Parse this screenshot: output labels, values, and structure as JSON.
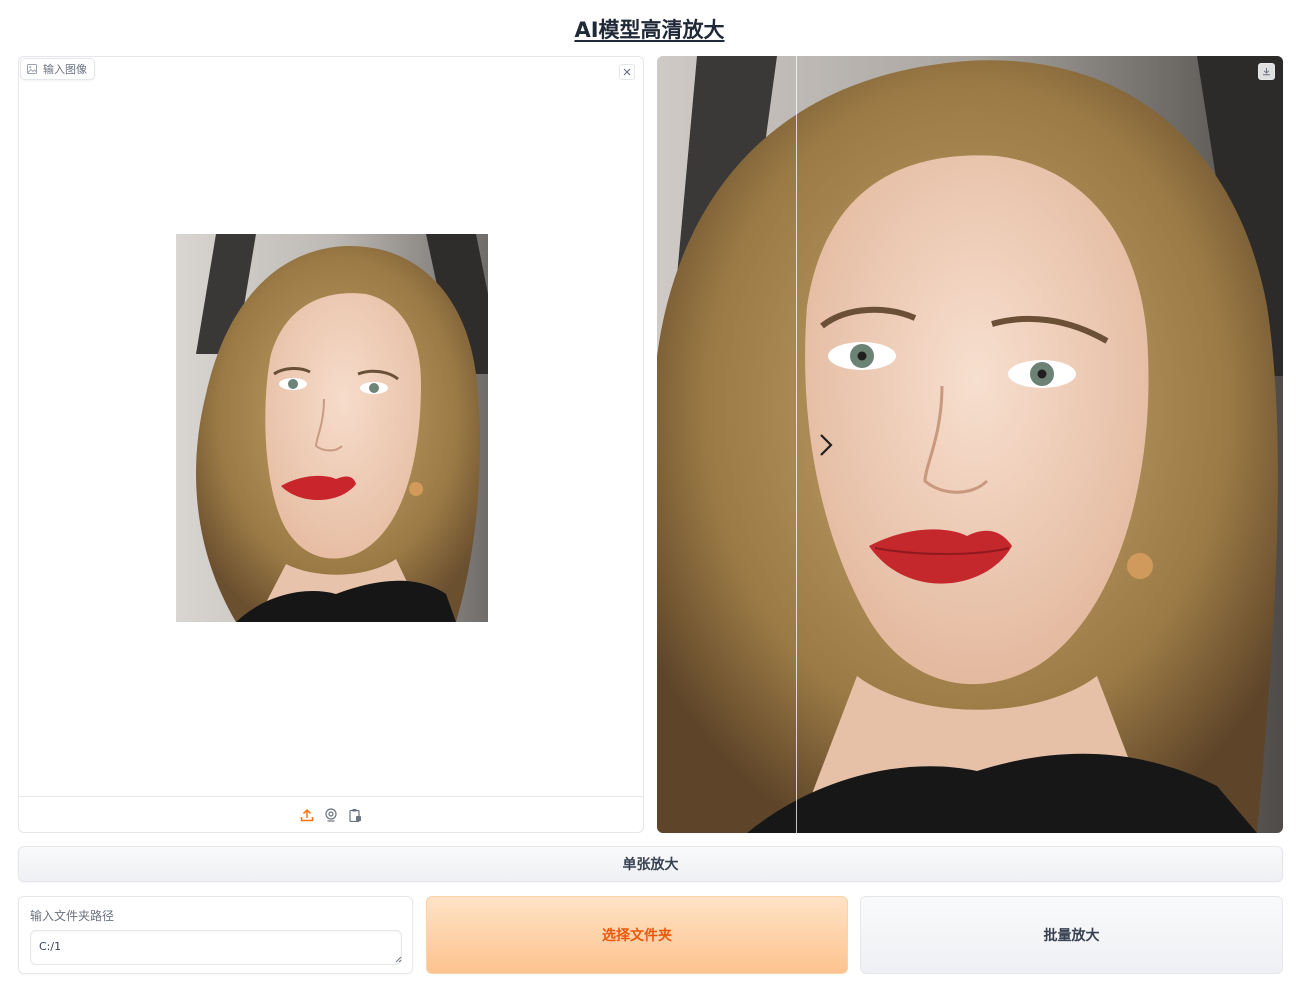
{
  "page": {
    "title": "AI模型高清放大"
  },
  "input_panel": {
    "label": "输入图像",
    "label_icon": "image-icon",
    "close_icon": "close-icon",
    "tools": [
      {
        "name": "upload-icon",
        "color": "#f97316"
      },
      {
        "name": "webcam-icon",
        "color": "#6b7280"
      },
      {
        "name": "clipboard-icon",
        "color": "#6b7280"
      }
    ]
  },
  "output_panel": {
    "download_icon": "download-icon",
    "slider_icon": "chevron-right-icon"
  },
  "buttons": {
    "single": "单张放大",
    "folder": "选择文件夹",
    "batch": "批量放大"
  },
  "path_field": {
    "label": "输入文件夹路径",
    "value": "C:/1"
  },
  "colors": {
    "accent": "#f97316",
    "folder_button_bg": "#fdc38f",
    "folder_button_text": "#ea580c"
  }
}
